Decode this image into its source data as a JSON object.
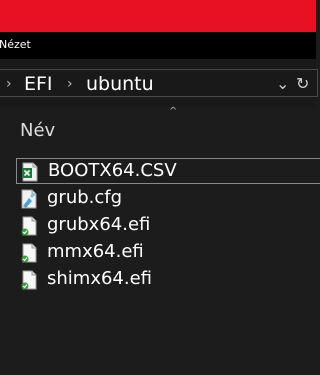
{
  "menubar": {
    "items": [
      {
        "label": "Nézet"
      }
    ]
  },
  "address": {
    "segments": [
      {
        "label": "EFI"
      },
      {
        "label": "ubuntu"
      }
    ]
  },
  "list": {
    "column_header": "Név",
    "files": [
      {
        "name": "BOOTX64.CSV",
        "icon": "spreadsheet-icon",
        "selected": true
      },
      {
        "name": "grub.cfg",
        "icon": "config-file-icon",
        "selected": false
      },
      {
        "name": "grubx64.efi",
        "icon": "efi-file-icon",
        "selected": false
      },
      {
        "name": "mmx64.efi",
        "icon": "efi-file-icon",
        "selected": false
      },
      {
        "name": "shimx64.efi",
        "icon": "efi-file-icon",
        "selected": false
      }
    ]
  },
  "colors": {
    "titlebar": "#e81123",
    "background": "#1c1c1c",
    "selection_border": "#8a8a8a"
  }
}
